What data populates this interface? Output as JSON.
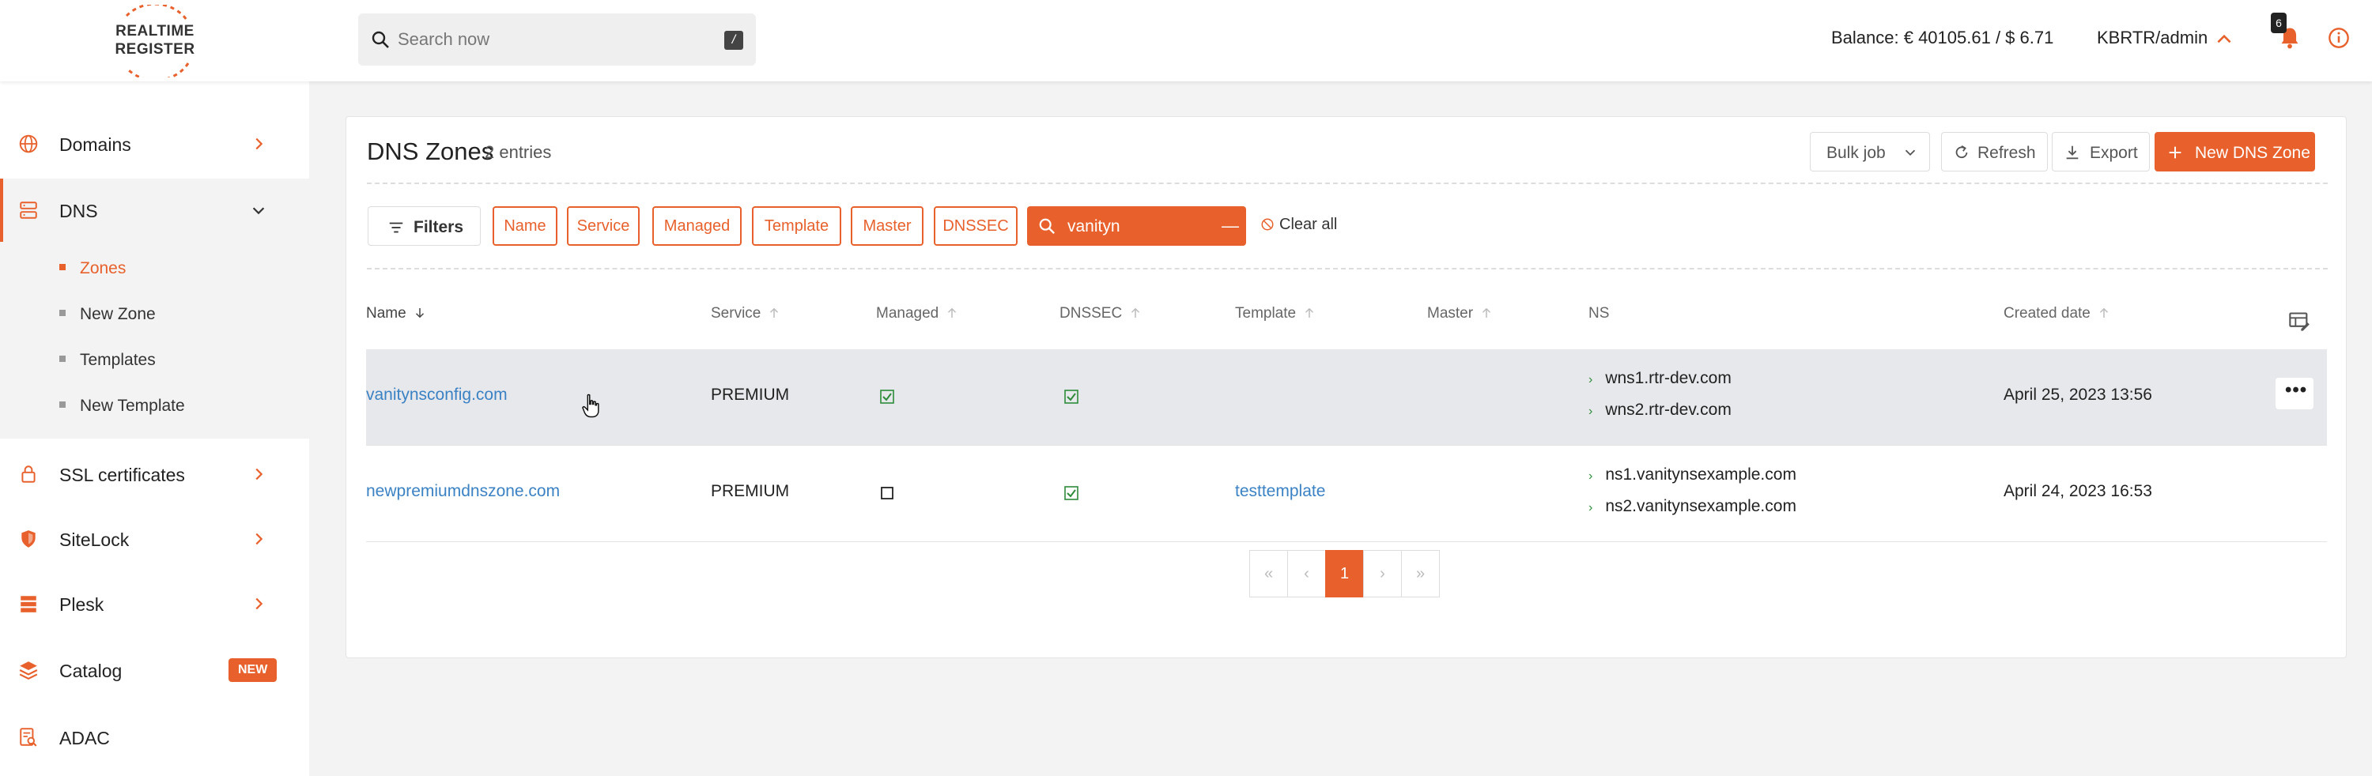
{
  "header": {
    "logo_line1": "REALTIME",
    "logo_line2": "REGISTER",
    "search_placeholder": "Search now",
    "search_shortcut": "/",
    "balance": "Balance: € 40105.61 / $ 6.71",
    "account": "KBRTR/admin",
    "notification_count": "6"
  },
  "sidebar": {
    "items": [
      {
        "label": "Domains",
        "icon": "globe-icon"
      },
      {
        "label": "DNS",
        "icon": "server-icon"
      },
      {
        "label": "SSL certificates",
        "icon": "lock-icon"
      },
      {
        "label": "SiteLock",
        "icon": "shield-icon"
      },
      {
        "label": "Plesk",
        "icon": "stack-icon"
      },
      {
        "label": "Catalog",
        "icon": "layers-icon",
        "badge": "NEW"
      },
      {
        "label": "ADAC",
        "icon": "document-search-icon"
      }
    ],
    "dns_subitems": [
      "Zones",
      "New Zone",
      "Templates",
      "New Template"
    ]
  },
  "page": {
    "title": "DNS Zones",
    "entry_count": "2 entries",
    "toolbar": {
      "bulk_job": "Bulk job",
      "refresh": "Refresh",
      "export": "Export",
      "new_zone": "New DNS Zone"
    },
    "filters_label": "Filters",
    "filter_chips": [
      "Name",
      "Service",
      "Managed",
      "Template",
      "Master",
      "DNSSEC"
    ],
    "search_value": "vanityn",
    "clear_all": "Clear all"
  },
  "table": {
    "columns": [
      "Name",
      "Service",
      "Managed",
      "DNSSEC",
      "Template",
      "Master",
      "NS",
      "Created date"
    ],
    "rows": [
      {
        "name": "vanitynsconfig.com",
        "service": "PREMIUM",
        "managed": true,
        "dnssec": true,
        "template": "",
        "master": "",
        "ns": [
          "wns1.rtr-dev.com",
          "wns2.rtr-dev.com"
        ],
        "created": "April 25, 2023 13:56"
      },
      {
        "name": "newpremiumdnszone.com",
        "service": "PREMIUM",
        "managed": false,
        "dnssec": true,
        "template": "testtemplate",
        "master": "",
        "ns": [
          "ns1.vanitynsexample.com",
          "ns2.vanitynsexample.com"
        ],
        "created": "April 24, 2023 16:53"
      }
    ]
  },
  "pagination": {
    "first": "«",
    "prev": "‹",
    "current": "1",
    "next": "›",
    "last": "»"
  },
  "colors": {
    "accent": "#e8612c",
    "link": "#3b82c4",
    "check": "#2e8b3a"
  }
}
